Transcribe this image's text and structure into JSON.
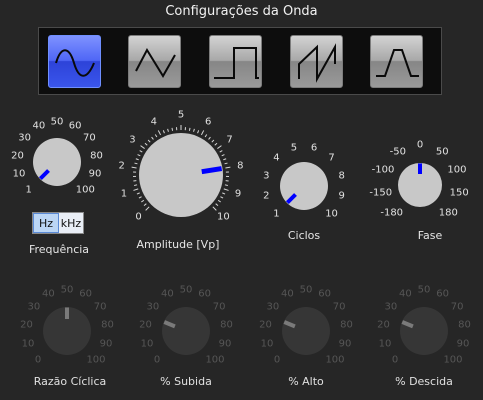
{
  "title": "Configurações da Onda",
  "waveforms": [
    {
      "name": "sine",
      "active": true
    },
    {
      "name": "triangle",
      "active": false
    },
    {
      "name": "square",
      "active": false
    },
    {
      "name": "sawtooth",
      "active": false
    },
    {
      "name": "trapezoid",
      "active": false
    }
  ],
  "colors": {
    "accent_blue": "#0000ff",
    "knob_gray": "#c8c8c8",
    "disabled_knob": "#363636",
    "background": "#262626"
  },
  "knobs": {
    "frequencia": {
      "label": "Frequência",
      "ticks": [
        "1",
        "10",
        "20",
        "30",
        "40",
        "50",
        "60",
        "70",
        "80",
        "90",
        "100"
      ],
      "value": 1,
      "units": [
        "Hz",
        "kHz"
      ],
      "selected_unit": "Hz"
    },
    "amplitude": {
      "label": "Amplitude [Vp]",
      "ticks": [
        "0",
        "1",
        "2",
        "3",
        "4",
        "5",
        "6",
        "7",
        "8",
        "9",
        "10"
      ],
      "value": 8
    },
    "ciclos": {
      "label": "Ciclos",
      "ticks": [
        "1",
        "2",
        "3",
        "4",
        "5",
        "6",
        "7",
        "8",
        "9",
        "10"
      ],
      "value": 1
    },
    "fase": {
      "label": "Fase",
      "ticks": [
        "-180",
        "-150",
        "-100",
        "-50",
        "0",
        "50",
        "100",
        "150",
        "180"
      ],
      "value": 0
    },
    "razao_ciclica": {
      "label": "Razão Cíclica",
      "ticks": [
        "0",
        "10",
        "20",
        "30",
        "40",
        "50",
        "60",
        "70",
        "80",
        "90",
        "100"
      ],
      "value": 50,
      "enabled": false
    },
    "subida": {
      "label": "% Subida",
      "ticks": [
        "0",
        "10",
        "20",
        "30",
        "40",
        "50",
        "60",
        "70",
        "80",
        "90",
        "100"
      ],
      "value": 25,
      "enabled": false
    },
    "alto": {
      "label": "% Alto",
      "ticks": [
        "0",
        "10",
        "20",
        "30",
        "40",
        "50",
        "60",
        "70",
        "80",
        "90",
        "100"
      ],
      "value": 25,
      "enabled": false
    },
    "descida": {
      "label": "% Descida",
      "ticks": [
        "0",
        "10",
        "20",
        "30",
        "40",
        "50",
        "60",
        "70",
        "80",
        "90",
        "100"
      ],
      "value": 25,
      "enabled": false
    }
  }
}
